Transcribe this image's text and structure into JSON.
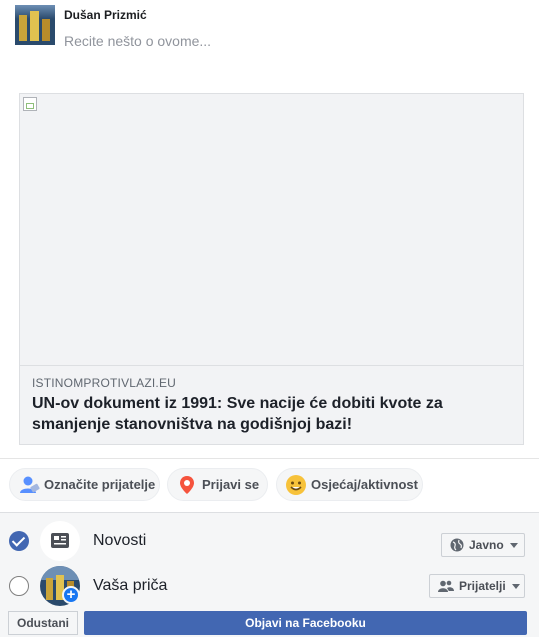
{
  "composer": {
    "author_name": "Dušan Prizmić",
    "placeholder": "Recite nešto o ovome..."
  },
  "link_preview": {
    "domain": "ISTINOMPROTIVLAZI.EU",
    "title": "UN-ov dokument iz 1991: Sve nacije će dobiti kvote za smanjenje stanovništva na godišnjoj bazi!"
  },
  "actions": [
    {
      "label": "Označite prijatelje",
      "icon": "tag-friends-icon"
    },
    {
      "label": "Prijavi se",
      "icon": "map-pin-icon"
    },
    {
      "label": "Osjećaj/aktivnost",
      "icon": "smiley-icon"
    }
  ],
  "destinations": [
    {
      "label": "Novosti",
      "checked": true,
      "privacy": "Javno",
      "privacy_icon": "globe-icon"
    },
    {
      "label": "Vaša priča",
      "checked": false,
      "privacy": "Prijatelji",
      "privacy_icon": "friends-icon"
    }
  ],
  "footer": {
    "cancel_label": "Odustani",
    "post_label": "Objavi na Facebooku"
  },
  "colors": {
    "accent": "#4267b2",
    "panel": "#f5f6f7"
  }
}
